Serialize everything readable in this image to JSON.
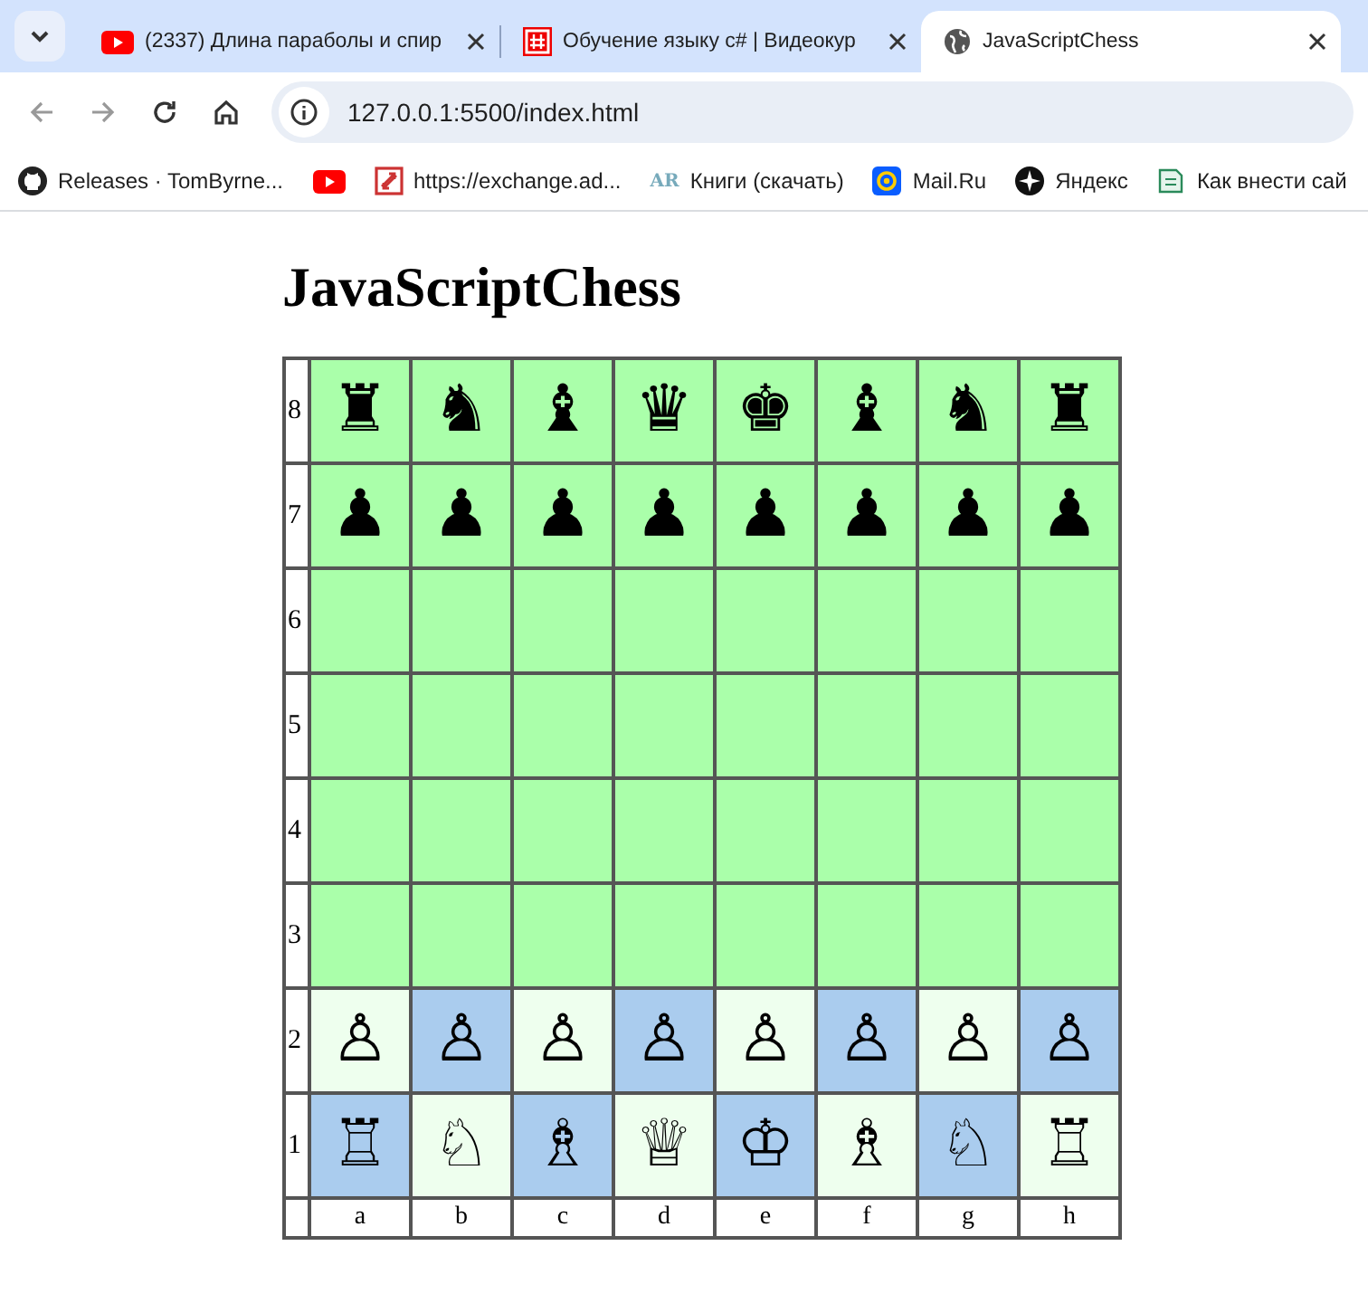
{
  "tabs": [
    {
      "title": "(2337) Длина параболы и спир",
      "kind": "youtube",
      "selected": false
    },
    {
      "title": "Обучение языку c# | Видеокур",
      "kind": "csharp",
      "selected": false
    },
    {
      "title": "JavaScriptChess",
      "kind": "globe",
      "selected": true
    }
  ],
  "address": "127.0.0.1:5500/index.html",
  "bookmarks": [
    {
      "label": "Releases · TomByrne...",
      "kind": "github"
    },
    {
      "kind": "youtube"
    },
    {
      "label": "https://exchange.ad...",
      "kind": "exchange"
    },
    {
      "label": "Книги (скачать)",
      "kind": "text",
      "icon_text": "AR"
    },
    {
      "label": "Mail.Ru",
      "kind": "mail"
    },
    {
      "label": "Яндекс",
      "kind": "star"
    },
    {
      "label": "Как внести сай",
      "kind": "doc"
    }
  ],
  "page": {
    "heading": "JavaScriptChess",
    "board": {
      "rows": [
        {
          "rank": "8",
          "cells": [
            {
              "piece": "♜",
              "color": "#aaffaa"
            },
            {
              "piece": "♞",
              "color": "#aaffaa"
            },
            {
              "piece": "♝",
              "color": "#aaffaa"
            },
            {
              "piece": "♛",
              "color": "#aaffaa"
            },
            {
              "piece": "♚",
              "color": "#aaffaa"
            },
            {
              "piece": "♝",
              "color": "#aaffaa"
            },
            {
              "piece": "♞",
              "color": "#aaffaa"
            },
            {
              "piece": "♜",
              "color": "#aaffaa"
            }
          ]
        },
        {
          "rank": "7",
          "cells": [
            {
              "piece": "♟",
              "color": "#aaffaa"
            },
            {
              "piece": "♟",
              "color": "#aaffaa"
            },
            {
              "piece": "♟",
              "color": "#aaffaa"
            },
            {
              "piece": "♟",
              "color": "#aaffaa"
            },
            {
              "piece": "♟",
              "color": "#aaffaa"
            },
            {
              "piece": "♟",
              "color": "#aaffaa"
            },
            {
              "piece": "♟",
              "color": "#aaffaa"
            },
            {
              "piece": "♟",
              "color": "#aaffaa"
            }
          ]
        },
        {
          "rank": "6",
          "cells": [
            {
              "color": "#aaffaa"
            },
            {
              "color": "#aaffaa"
            },
            {
              "color": "#aaffaa"
            },
            {
              "color": "#aaffaa"
            },
            {
              "color": "#aaffaa"
            },
            {
              "color": "#aaffaa"
            },
            {
              "color": "#aaffaa"
            },
            {
              "color": "#aaffaa"
            }
          ]
        },
        {
          "rank": "5",
          "cells": [
            {
              "color": "#aaffaa"
            },
            {
              "color": "#aaffaa"
            },
            {
              "color": "#aaffaa"
            },
            {
              "color": "#aaffaa"
            },
            {
              "color": "#aaffaa"
            },
            {
              "color": "#aaffaa"
            },
            {
              "color": "#aaffaa"
            },
            {
              "color": "#aaffaa"
            }
          ]
        },
        {
          "rank": "4",
          "cells": [
            {
              "color": "#aaffaa"
            },
            {
              "color": "#aaffaa"
            },
            {
              "color": "#aaffaa"
            },
            {
              "color": "#aaffaa"
            },
            {
              "color": "#aaffaa"
            },
            {
              "color": "#aaffaa"
            },
            {
              "color": "#aaffaa"
            },
            {
              "color": "#aaffaa"
            }
          ]
        },
        {
          "rank": "3",
          "cells": [
            {
              "color": "#aaffaa"
            },
            {
              "color": "#aaffaa"
            },
            {
              "color": "#aaffaa"
            },
            {
              "color": "#aaffaa"
            },
            {
              "color": "#aaffaa"
            },
            {
              "color": "#aaffaa"
            },
            {
              "color": "#aaffaa"
            },
            {
              "color": "#aaffaa"
            }
          ]
        },
        {
          "rank": "2",
          "cells": [
            {
              "piece": "♙",
              "color": "#eeffee"
            },
            {
              "piece": "♙",
              "color": "#aaccee"
            },
            {
              "piece": "♙",
              "color": "#eeffee"
            },
            {
              "piece": "♙",
              "color": "#aaccee"
            },
            {
              "piece": "♙",
              "color": "#eeffee"
            },
            {
              "piece": "♙",
              "color": "#aaccee"
            },
            {
              "piece": "♙",
              "color": "#eeffee"
            },
            {
              "piece": "♙",
              "color": "#aaccee"
            }
          ]
        },
        {
          "rank": "1",
          "cells": [
            {
              "piece": "♖",
              "color": "#aaccee"
            },
            {
              "piece": "♘",
              "color": "#eeffee"
            },
            {
              "piece": "♗",
              "color": "#aaccee"
            },
            {
              "piece": "♕",
              "color": "#eeffee"
            },
            {
              "piece": "♔",
              "color": "#aaccee"
            },
            {
              "piece": "♗",
              "color": "#eeffee"
            },
            {
              "piece": "♘",
              "color": "#aaccee"
            },
            {
              "piece": "♖",
              "color": "#eeffee"
            }
          ]
        }
      ],
      "files": [
        "a",
        "b",
        "c",
        "d",
        "e",
        "f",
        "g",
        "h"
      ]
    }
  }
}
